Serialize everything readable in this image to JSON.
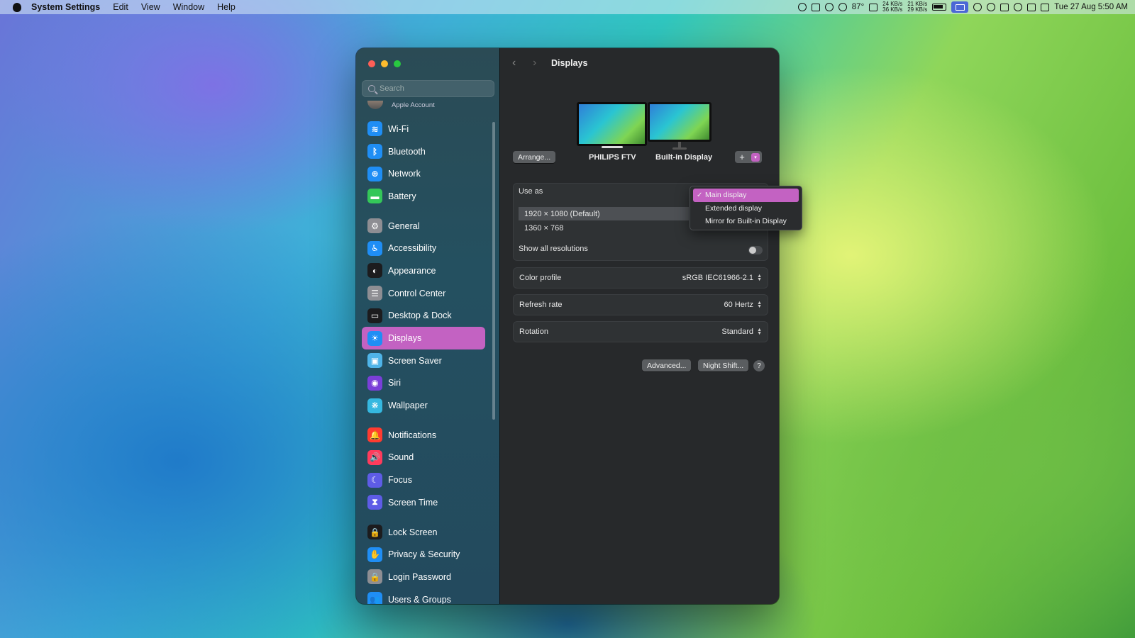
{
  "menubar": {
    "app_name": "System Settings",
    "menus": [
      "Edit",
      "View",
      "Window",
      "Help"
    ],
    "status": {
      "temperature": "87°",
      "net_up": "24 KB/s",
      "net_down": "36 KB/s",
      "net_up2": "21 KB/s",
      "net_down2": "29 KB/s",
      "date_time": "Tue 27 Aug  5:50 AM"
    }
  },
  "sidebar": {
    "search_placeholder": "Search",
    "account_label": "Apple Account",
    "items": [
      {
        "label": "Wi-Fi",
        "icon": "wifi-icon",
        "color": "#1f8ef5",
        "glyph": "≋"
      },
      {
        "label": "Bluetooth",
        "icon": "bluetooth-icon",
        "color": "#1f8ef5",
        "glyph": "ᛒ"
      },
      {
        "label": "Network",
        "icon": "globe-icon",
        "color": "#1f8ef5",
        "glyph": "⊕"
      },
      {
        "label": "Battery",
        "icon": "battery-icon",
        "color": "#34c759",
        "glyph": "▬"
      },
      {
        "label": "General",
        "icon": "gear-icon",
        "color": "#8e8e93",
        "glyph": "⚙"
      },
      {
        "label": "Accessibility",
        "icon": "accessibility-icon",
        "color": "#1f8ef5",
        "glyph": "♿"
      },
      {
        "label": "Appearance",
        "icon": "appearance-icon",
        "color": "#1c1c1e",
        "glyph": "◐"
      },
      {
        "label": "Control Center",
        "icon": "control-center-icon",
        "color": "#8e8e93",
        "glyph": "☰"
      },
      {
        "label": "Desktop & Dock",
        "icon": "dock-icon",
        "color": "#1c1c1e",
        "glyph": "▭"
      },
      {
        "label": "Displays",
        "icon": "displays-icon",
        "color": "#1f8ef5",
        "glyph": "☀"
      },
      {
        "label": "Screen Saver",
        "icon": "screen-saver-icon",
        "color": "#4fb4e8",
        "glyph": "▣"
      },
      {
        "label": "Siri",
        "icon": "siri-icon",
        "color": "#7a3fd8",
        "glyph": "◉"
      },
      {
        "label": "Wallpaper",
        "icon": "wallpaper-icon",
        "color": "#35b8e0",
        "glyph": "❋"
      },
      {
        "label": "Notifications",
        "icon": "bell-icon",
        "color": "#ff3b30",
        "glyph": "🔔"
      },
      {
        "label": "Sound",
        "icon": "speaker-icon",
        "color": "#ff3b5c",
        "glyph": "🔊"
      },
      {
        "label": "Focus",
        "icon": "moon-icon",
        "color": "#5e5ce6",
        "glyph": "☾"
      },
      {
        "label": "Screen Time",
        "icon": "hourglass-icon",
        "color": "#5e5ce6",
        "glyph": "⧗"
      },
      {
        "label": "Lock Screen",
        "icon": "lock-icon",
        "color": "#1c1c1e",
        "glyph": "🔒"
      },
      {
        "label": "Privacy & Security",
        "icon": "hand-icon",
        "color": "#1f8ef5",
        "glyph": "✋"
      },
      {
        "label": "Login Password",
        "icon": "password-lock-icon",
        "color": "#8e8e93",
        "glyph": "🔒"
      },
      {
        "label": "Users & Groups",
        "icon": "users-icon",
        "color": "#1f8ef5",
        "glyph": "👥"
      }
    ],
    "selected": "Displays"
  },
  "main": {
    "title": "Displays",
    "arrange_label": "Arrange...",
    "displays": [
      "PHILIPS FTV",
      "Built-in Display"
    ],
    "add_label": "+",
    "use_as_label": "Use as",
    "resolutions": [
      "1920 × 1080 (Default)",
      "1360 × 768"
    ],
    "show_all_label": "Show all resolutions",
    "show_all_on": false,
    "color_profile_label": "Color profile",
    "color_profile_value": "sRGB IEC61966-2.1",
    "refresh_rate_label": "Refresh rate",
    "refresh_rate_value": "60 Hertz",
    "rotation_label": "Rotation",
    "rotation_value": "Standard",
    "advanced_label": "Advanced...",
    "night_shift_label": "Night Shift...",
    "help_label": "?"
  },
  "use_as_menu": {
    "items": [
      "Main display",
      "Extended display",
      "Mirror for Built-in Display"
    ],
    "selected": "Main display",
    "check": "✓"
  },
  "colors": {
    "accent": "#c362c2"
  }
}
